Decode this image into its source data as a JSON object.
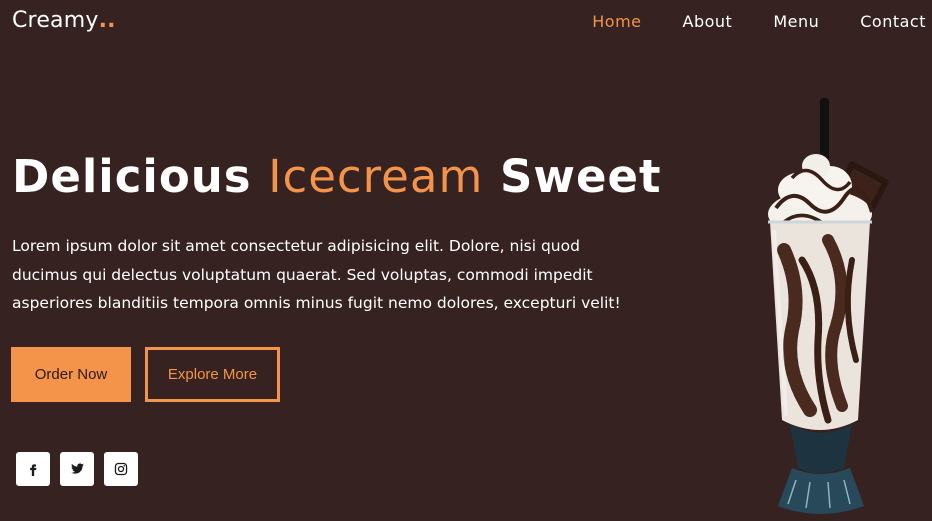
{
  "brand": {
    "name": "Creamy",
    "dots": ".."
  },
  "nav": {
    "items": [
      {
        "label": "Home",
        "active": true
      },
      {
        "label": "About",
        "active": false
      },
      {
        "label": "Menu",
        "active": false
      },
      {
        "label": "Contact",
        "active": false
      }
    ]
  },
  "hero": {
    "title_part1": "Delicious",
    "title_accent": "Icecream",
    "title_part2": "Sweet",
    "description": "Lorem ipsum dolor sit amet consectetur adipisicing elit. Dolore, nisi quod ducimus qui delectus voluptatum quaerat. Sed voluptas, commodi impedit asperiores blanditiis tempora omnis minus fugit nemo dolores, excepturi velit!",
    "order_button": "Order Now",
    "explore_button": "Explore More"
  },
  "social": [
    {
      "icon": "facebook-icon"
    },
    {
      "icon": "twitter-icon"
    },
    {
      "icon": "instagram-icon"
    }
  ],
  "colors": {
    "background": "#362321",
    "accent": "#f4934a",
    "text": "#ffffff"
  }
}
